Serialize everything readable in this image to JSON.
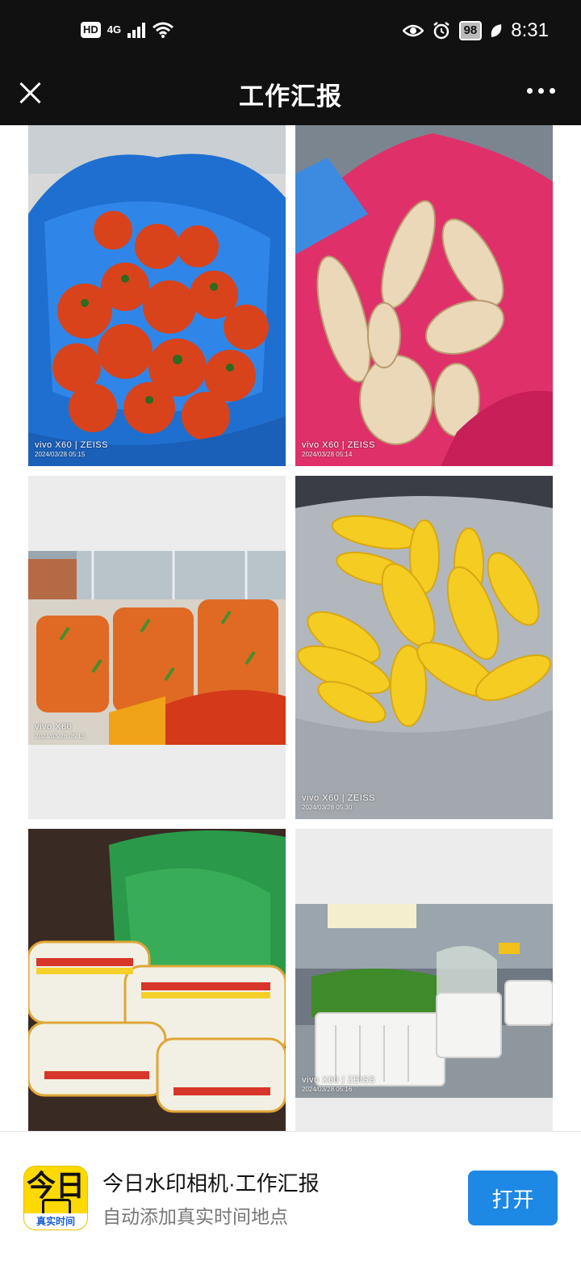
{
  "status_bar": {
    "hd": "HD",
    "network": "4G",
    "battery": "98",
    "time": "8:31"
  },
  "nav": {
    "title": "工作汇报"
  },
  "photos": [
    {
      "brand": "vivo X60 | ZEISS",
      "timestamp": "2024/03/28 05:15"
    },
    {
      "brand": "vivo X60 | ZEISS",
      "timestamp": "2024/03/28 05:14"
    },
    {
      "brand": "vivo X60",
      "timestamp": "2024/03/28 05:13"
    },
    {
      "brand": "vivo X60 | ZEISS",
      "timestamp": "2024/03/28 05:30"
    },
    {
      "brand": "",
      "timestamp": ""
    },
    {
      "brand": "vivo X60 | ZEISS",
      "timestamp": "2024/03/28 05:16"
    }
  ],
  "banner": {
    "logo_text": "今日",
    "logo_strip": "真实时间",
    "title": "今日水印相机·工作汇报",
    "subtitle": "自动添加真实时间地点",
    "open_label": "打开"
  }
}
